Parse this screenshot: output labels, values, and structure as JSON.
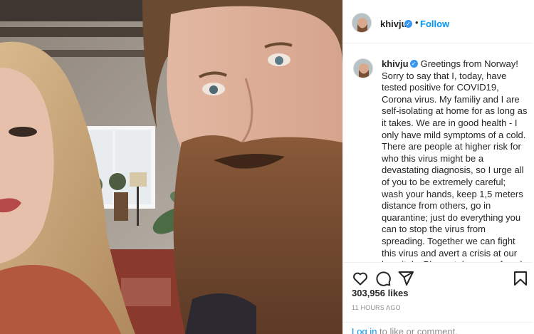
{
  "post": {
    "username": "khivju",
    "follow_label": "Follow",
    "dot": "•",
    "caption": "Greetings from Norway! Sorry to say that I, today, have tested positive for COVID19, Corona virus. My familiy and I are self-isolating at home for as long as it takes. We are in good health - I only have mild symptoms of a cold. There are people at higher risk for who this virus might be a devastating diagnosis, so I urge all of you to be extremely careful; wash your hands, keep 1,5 meters distance from others, go in quarantine; just do everything you can to stop the virus from spreading. Together we can fight this virus and avert a crisis at our hospitals. Please take care of each other, keep your distance, and stay healthy! Please visit your country's Center for Disease Control's website, and follow the",
    "likes": "303,956 likes",
    "time": "11 HOURS AGO",
    "login_link": "Log in",
    "login_rest": " to like or comment."
  },
  "icons": {
    "verified": "verified-badge-icon",
    "like": "heart-icon",
    "comment": "comment-icon",
    "share": "share-icon",
    "save": "bookmark-icon"
  },
  "colors": {
    "accent": "#0095f6",
    "verified": "#3897f0",
    "text": "#262626",
    "muted": "#8e8e8e",
    "border": "#efefef"
  }
}
